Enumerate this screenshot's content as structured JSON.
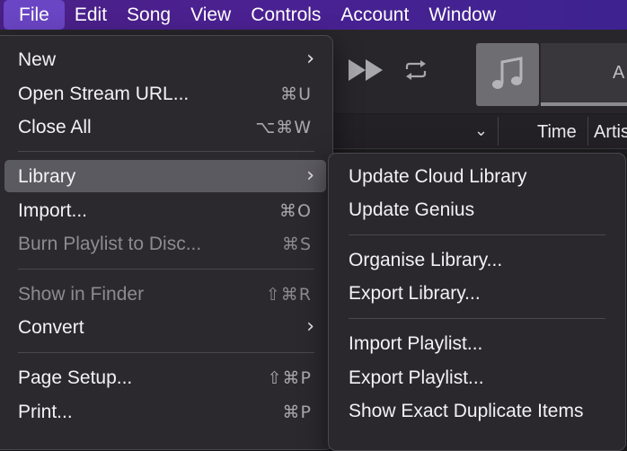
{
  "menubar": {
    "items": [
      "File",
      "Edit",
      "Song",
      "View",
      "Controls",
      "Account",
      "Window"
    ]
  },
  "background": {
    "header": {
      "sort_chevron": "⌄",
      "time_label": "Time",
      "artist_label": "Artis"
    },
    "nowplaying": {
      "text_fragment": "A"
    },
    "artwork": {
      "icon": "music-note-icon"
    }
  },
  "file_menu": {
    "new": {
      "label": "New"
    },
    "open_stream": {
      "label": "Open Stream URL...",
      "shortcut": "⌘U"
    },
    "close_all": {
      "label": "Close All",
      "shortcut": "⌥⌘W"
    },
    "library": {
      "label": "Library"
    },
    "import": {
      "label": "Import...",
      "shortcut": "⌘O"
    },
    "burn": {
      "label": "Burn Playlist to Disc...",
      "shortcut": "⌘S"
    },
    "show_in_finder": {
      "label": "Show in Finder",
      "shortcut": "⇧⌘R"
    },
    "convert": {
      "label": "Convert"
    },
    "page_setup": {
      "label": "Page Setup...",
      "shortcut": "⇧⌘P"
    },
    "print": {
      "label": "Print...",
      "shortcut": "⌘P"
    }
  },
  "library_menu": {
    "update_cloud": "Update Cloud Library",
    "update_genius": "Update Genius",
    "organise": "Organise Library...",
    "export_library": "Export Library...",
    "import_playlist": "Import Playlist...",
    "export_playlist": "Export Playlist...",
    "show_duplicates": "Show Exact Duplicate Items"
  },
  "colors": {
    "menubar": "#4b2192",
    "menubar_active": "#6a45c4",
    "menu_bg": "#2b292e",
    "selected_item": "#5c5a61"
  }
}
